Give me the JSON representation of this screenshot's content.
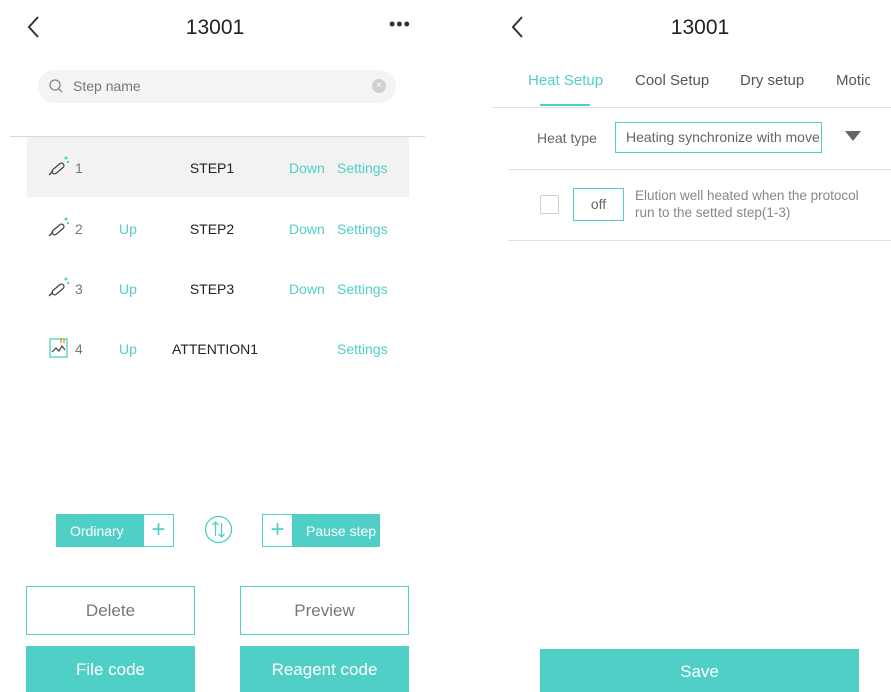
{
  "left": {
    "title": "13001",
    "more_label": "•••",
    "search": {
      "placeholder": "Step name"
    },
    "steps": [
      {
        "num": "1",
        "up": "",
        "name": "STEP1",
        "down": "Down",
        "settings": "Settings"
      },
      {
        "num": "2",
        "up": "Up",
        "name": "STEP2",
        "down": "Down",
        "settings": "Settings"
      },
      {
        "num": "3",
        "up": "Up",
        "name": "STEP3",
        "down": "Down",
        "settings": "Settings"
      },
      {
        "num": "4",
        "up": "Up",
        "name": "ATTENTION1",
        "down": "",
        "settings": "Settings"
      }
    ],
    "ordinary_label": "Ordinary",
    "pause_label": "Pause step",
    "plus": "+",
    "delete_label": "Delete",
    "preview_label": "Preview",
    "file_code_label": "File code",
    "reagent_code_label": "Reagent code"
  },
  "right": {
    "title": "13001",
    "tabs": [
      "Heat Setup",
      "Cool Setup",
      "Dry setup",
      "Motic"
    ],
    "heat_type_label": "Heat type",
    "heat_type_value": "Heating synchronize with move",
    "off_label": "off",
    "elution_text": "Elution well heated when the protocol run to the setted step(1-3)",
    "save_label": "Save"
  },
  "colors": {
    "accent": "#4fcfc6"
  }
}
